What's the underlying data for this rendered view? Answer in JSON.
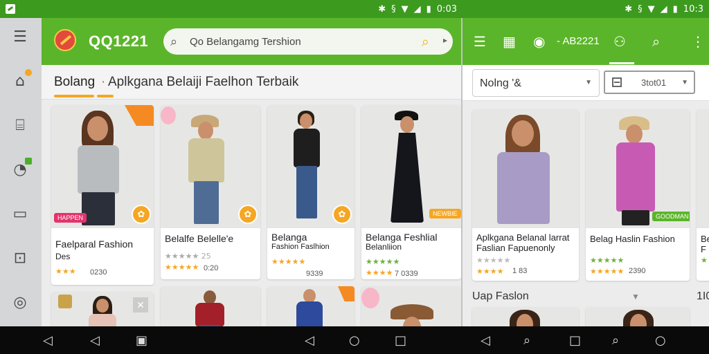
{
  "status_bar_left": {
    "time": "0:03",
    "icons": [
      "bluetooth-icon",
      "vibrate-icon",
      "wifi-icon",
      "signal-icon",
      "battery-icon"
    ]
  },
  "status_bar_right": {
    "time": "10:3",
    "icons": [
      "bluetooth-icon",
      "vibrate-icon",
      "wifi-icon",
      "signal-icon",
      "battery-icon"
    ]
  },
  "app": {
    "title": "QQ1221"
  },
  "search": {
    "value": "Qo Belangamg Tershion"
  },
  "category_bar": {
    "active": "Bolang",
    "rest": "Aplkgana  Belaiji Faelhon  Terbaik"
  },
  "sidebar": {
    "items": [
      "home-store-icon",
      "basket-icon",
      "timer-icon",
      "tablet-icon",
      "account-box-icon",
      "compass-icon"
    ]
  },
  "left_cards_row1": [
    {
      "name": "Faelparal Fashion",
      "sub": "Des",
      "stars": "★★★",
      "count": "0230"
    },
    {
      "name": "Belalfe Belelle'e",
      "sub": "",
      "stars": "★★★★★",
      "count": "0:20",
      "sub2": "★★★★★ 25"
    },
    {
      "name": "Belanga",
      "sub": "Fashion Faslhion",
      "stars": "★★★★★",
      "count": "9339"
    },
    {
      "name": "Belanga Feshlial",
      "sub": "Belanliion",
      "stars": "★★★★",
      "count": "7 0339"
    }
  ],
  "left_cards_row1_tags": {
    "card1": "HAPPEN",
    "card4": "NEWBIE"
  },
  "right_app": {
    "ident": "- AB2221"
  },
  "filters": {
    "left_value": "Nolng '&",
    "right_value": "3tot01"
  },
  "right_cards_row1": [
    {
      "name": "Aplkgana Belanal larrat Faslian Fapuenonly",
      "stars": "★★★★",
      "count": "1 83"
    },
    {
      "name": "Belag Haslin Fashion",
      "stars": "★★★★★",
      "count": "2390",
      "tag": "GOODMAN"
    },
    {
      "name": "Be F",
      "stars": "★",
      "count": ""
    }
  ],
  "right_section": {
    "title": "Uap Faslon",
    "title2": "1I0"
  },
  "colors": {
    "primary_green": "#5bb52a",
    "status_green": "#3c9a1e",
    "accent_orange": "#f5a623"
  },
  "nav_left": [
    "back-icon",
    "back-icon",
    "recents-icon",
    "back-icon",
    "home-icon",
    "recents-icon"
  ],
  "nav_right": [
    "back-icon",
    "search-icon",
    "recents-icon",
    "search-icon",
    "home-icon"
  ]
}
